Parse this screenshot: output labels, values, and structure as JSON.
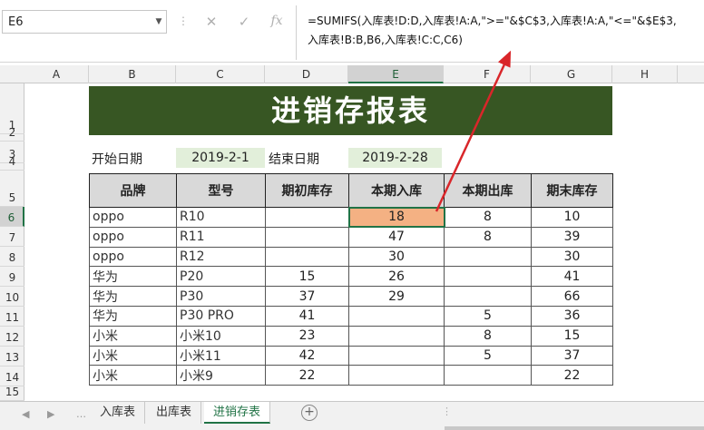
{
  "name_box": "E6",
  "formula_icons": {
    "cancel": "✕",
    "enter": "✓",
    "fx": "fx"
  },
  "formula": "=SUMIFS(入库表!D:D,入库表!A:A,\">=\"&$C$3,入库表!A:A,\"<=\"&$E$3,\n入库表!B:B,B6,入库表!C:C,C6)",
  "columns": [
    "A",
    "B",
    "C",
    "D",
    "E",
    "F",
    "G",
    "H"
  ],
  "rows": [
    "1",
    "2",
    "3",
    "4",
    "5",
    "6",
    "7",
    "8",
    "9",
    "10",
    "11",
    "12",
    "13",
    "14",
    "15"
  ],
  "title": "进销存报表",
  "start_label": "开始日期",
  "start_date": "2019-2-1",
  "end_label": "结束日期",
  "end_date": "2019-2-28",
  "table": {
    "headers": [
      "品牌",
      "型号",
      "期初库存",
      "本期入库",
      "本期出库",
      "期末库存"
    ],
    "rows": [
      [
        "oppo",
        "R10",
        "",
        "18",
        "8",
        "10"
      ],
      [
        "oppo",
        "R11",
        "",
        "47",
        "8",
        "39"
      ],
      [
        "oppo",
        "R12",
        "",
        "30",
        "",
        "30"
      ],
      [
        "华为",
        "P20",
        "15",
        "26",
        "",
        "41"
      ],
      [
        "华为",
        "P30",
        "37",
        "29",
        "",
        "66"
      ],
      [
        "华为",
        "P30 PRO",
        "41",
        "",
        "5",
        "36"
      ],
      [
        "小米",
        "小米10",
        "23",
        "",
        "8",
        "15"
      ],
      [
        "小米",
        "小米11",
        "42",
        "",
        "5",
        "37"
      ],
      [
        "小米",
        "小米9",
        "22",
        "",
        "",
        "22"
      ]
    ]
  },
  "tabs": [
    "入库表",
    "出库表",
    "进销存表"
  ],
  "active_tab": "进销存表",
  "accent_color": "#217346",
  "title_bg": "#375623",
  "highlight_color": "#f4b183",
  "arrow_color": "#d9262a"
}
